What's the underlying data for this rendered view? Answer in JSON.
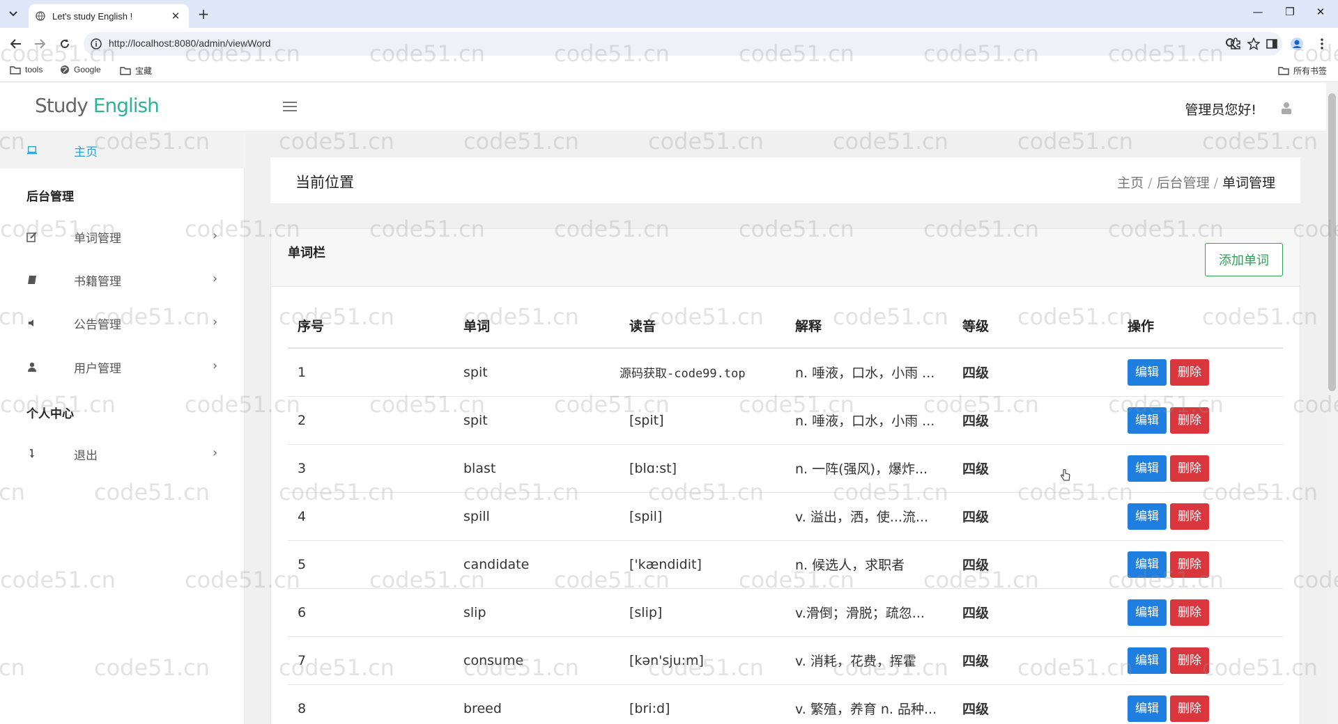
{
  "browser": {
    "tab_title": "Let's study English !",
    "url": "http://localhost:8080/admin/viewWord",
    "bookmarks": [
      "tools",
      "Google",
      "宝藏"
    ],
    "all_bookmarks": "所有书签"
  },
  "header": {
    "logo_part1": "Study",
    "logo_part2": "English",
    "greeting": "管理员您好!"
  },
  "sidebar": {
    "home": "主页",
    "section_admin": "后台管理",
    "items": [
      {
        "label": "单词管理",
        "icon": "edit-icon"
      },
      {
        "label": "书籍管理",
        "icon": "book-icon"
      },
      {
        "label": "公告管理",
        "icon": "volume-icon"
      },
      {
        "label": "用户管理",
        "icon": "user-icon"
      }
    ],
    "section_personal": "个人中心",
    "logout": "退出"
  },
  "main": {
    "crumb_title": "当前位置",
    "breadcrumb": [
      "主页",
      "后台管理",
      "单词管理"
    ],
    "card_title": "单词栏",
    "add_button": "添加单词",
    "columns": [
      "序号",
      "单词",
      "读音",
      "解释",
      "等级",
      "操作"
    ],
    "edit_label": "编辑",
    "delete_label": "删除",
    "rows": [
      {
        "no": "1",
        "word": "spit",
        "phonetic": "源码获取-code99.top",
        "meaning": "n. 唾液，口水，小雨 ...",
        "level": "四级"
      },
      {
        "no": "2",
        "word": "spit",
        "phonetic": "[spit]",
        "meaning": "n. 唾液，口水，小雨 ...",
        "level": "四级"
      },
      {
        "no": "3",
        "word": "blast",
        "phonetic": "[blɑ:st]",
        "meaning": "n. 一阵(强风)，爆炸...",
        "level": "四级"
      },
      {
        "no": "4",
        "word": "spill",
        "phonetic": "[spil]",
        "meaning": "v. 溢出，洒，使...流...",
        "level": "四级"
      },
      {
        "no": "5",
        "word": "candidate",
        "phonetic": "['kændidit]",
        "meaning": "n. 候选人，求职者",
        "level": "四级"
      },
      {
        "no": "6",
        "word": "slip",
        "phonetic": "[slip]",
        "meaning": "v.滑倒；滑脱；疏忽...",
        "level": "四级"
      },
      {
        "no": "7",
        "word": "consume",
        "phonetic": "[kən'sju:m]",
        "meaning": "v. 消耗，花费，挥霍",
        "level": "四级"
      },
      {
        "no": "8",
        "word": "breed",
        "phonetic": "[bri:d]",
        "meaning": "v. 繁殖，养育 n. 品种...",
        "level": "四级"
      }
    ]
  },
  "watermark_text": "code51.cn"
}
